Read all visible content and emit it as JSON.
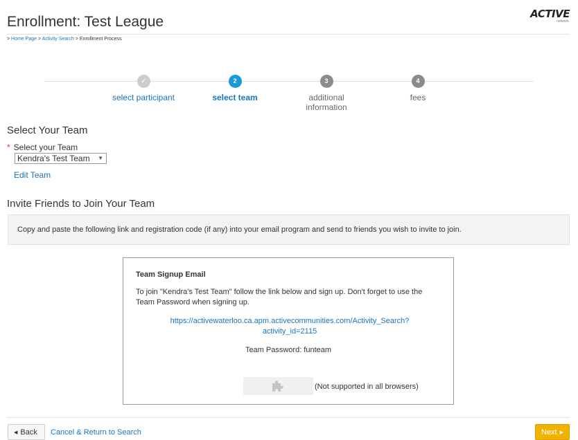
{
  "header": {
    "title": "Enrollment: Test League",
    "logo_main": "ACTIVE",
    "logo_sub": "network."
  },
  "breadcrumb": {
    "prefix": "> ",
    "home": "Home Page",
    "sep1": " > ",
    "activity_search": "Activity Search",
    "sep2": " > ",
    "current": "Enrollment Process"
  },
  "stepper": {
    "steps": [
      {
        "number": "✓",
        "label": "select participant",
        "state": "done"
      },
      {
        "number": "2",
        "label": "select team",
        "state": "active"
      },
      {
        "number": "3",
        "label": "additional information",
        "state": "todo"
      },
      {
        "number": "4",
        "label": "fees",
        "state": "todo"
      }
    ]
  },
  "select_team": {
    "heading": "Select Your Team",
    "required_mark": "*",
    "field_label": "Select your Team",
    "selected_value": "Kendra's Test Team",
    "arrow_glyph": "▼",
    "edit_link": "Edit Team"
  },
  "invite": {
    "heading": "Invite Friends to Join Your Team",
    "instructions": "Copy and paste the following link and registration code (if any) into your email program and send to friends you wish to invite to join.",
    "email": {
      "title": "Team Signup Email",
      "body": "To join \"Kendra's Test Team\" follow the link below and sign up. Don't forget to use the Team Password when signing up.",
      "link": "https://activewaterloo.ca.apm.activecommunities.com/Activity_Search?activity_id=2115",
      "password_line": "Team Password: funteam",
      "plugin_note": "(Not supported in all browsers)",
      "plugin_icon": "puzzle-piece-icon"
    }
  },
  "footer": {
    "back_label": "Back",
    "back_glyph": "◀",
    "cancel_label": "Cancel & Return to Search",
    "next_label": "Next",
    "next_glyph": "▶"
  },
  "colors": {
    "link": "#1a75bb",
    "active_step": "#1a9ad6",
    "next_button": "#f0b400",
    "required": "#d9322a"
  }
}
